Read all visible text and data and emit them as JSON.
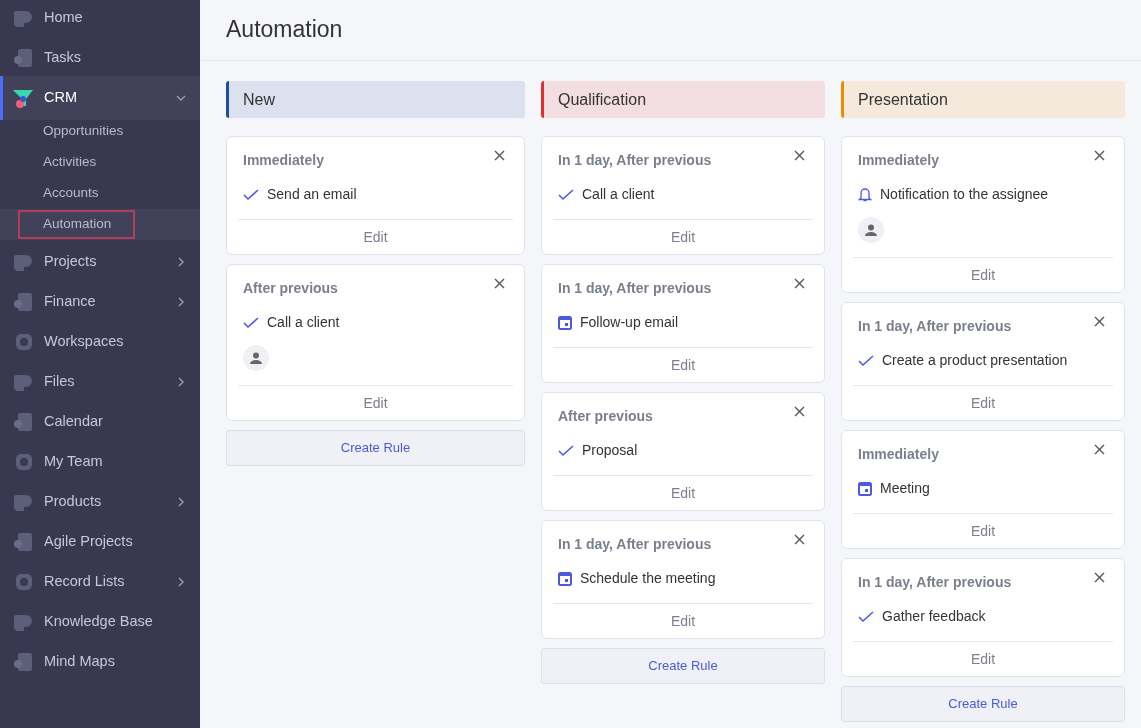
{
  "sidebar": {
    "items": [
      {
        "label": "Home",
        "selected": false
      },
      {
        "label": "Tasks",
        "selected": false
      },
      {
        "label": "CRM",
        "selected": true,
        "expanded": true,
        "children": [
          {
            "label": "Opportunities",
            "selected": false
          },
          {
            "label": "Activities",
            "selected": false
          },
          {
            "label": "Accounts",
            "selected": false
          },
          {
            "label": "Automation",
            "selected": true
          }
        ]
      },
      {
        "label": "Projects",
        "selected": false,
        "expanded": false
      },
      {
        "label": "Finance",
        "selected": false,
        "expanded": false
      },
      {
        "label": "Workspaces",
        "selected": false
      },
      {
        "label": "Files",
        "selected": false,
        "expanded": false
      },
      {
        "label": "Calendar",
        "selected": false
      },
      {
        "label": "My Team",
        "selected": false
      },
      {
        "label": "Products",
        "selected": false,
        "expanded": false
      },
      {
        "label": "Agile Projects",
        "selected": false
      },
      {
        "label": "Record Lists",
        "selected": false,
        "expanded": false
      },
      {
        "label": "Knowledge Base",
        "selected": false
      },
      {
        "label": "Mind Maps",
        "selected": false
      }
    ]
  },
  "page": {
    "title": "Automation"
  },
  "columns": [
    {
      "title": "New",
      "color": "#1f4e9c",
      "create_label": "Create Rule",
      "rules": [
        {
          "timing": "Immediately",
          "action": "Send an email",
          "kind": "task",
          "assignee": false,
          "edit_label": "Edit"
        },
        {
          "timing": "After previous",
          "action": "Call a client",
          "kind": "task",
          "assignee": true,
          "edit_label": "Edit"
        }
      ]
    },
    {
      "title": "Qualification",
      "color": "#e03131",
      "create_label": "Create Rule",
      "rules": [
        {
          "timing": "In 1 day, After previous",
          "action": "Call a client",
          "kind": "task",
          "assignee": false,
          "edit_label": "Edit"
        },
        {
          "timing": "In 1 day, After previous",
          "action": "Follow-up email",
          "kind": "calendar",
          "assignee": false,
          "edit_label": "Edit"
        },
        {
          "timing": "After previous",
          "action": "Proposal",
          "kind": "task",
          "assignee": false,
          "edit_label": "Edit"
        },
        {
          "timing": "In 1 day, After previous",
          "action": "Schedule the meeting",
          "kind": "calendar",
          "assignee": false,
          "edit_label": "Edit"
        }
      ]
    },
    {
      "title": "Presentation",
      "color": "#f08c00",
      "create_label": "Create Rule",
      "rules": [
        {
          "timing": "Immediately",
          "action": "Notification to the assignee",
          "kind": "notification",
          "assignee": true,
          "edit_label": "Edit"
        },
        {
          "timing": "In 1 day, After previous",
          "action": "Create a product presentation",
          "kind": "task",
          "assignee": false,
          "edit_label": "Edit"
        },
        {
          "timing": "Immediately",
          "action": "Meeting",
          "kind": "calendar",
          "assignee": false,
          "edit_label": "Edit"
        },
        {
          "timing": "In 1 day, After previous",
          "action": "Gather feedback",
          "kind": "task",
          "assignee": false,
          "edit_label": "Edit"
        }
      ]
    }
  ]
}
